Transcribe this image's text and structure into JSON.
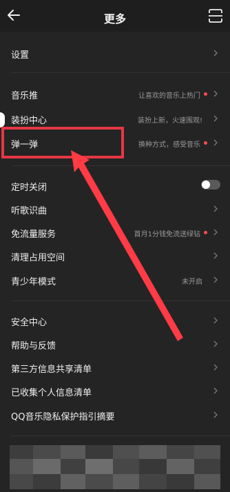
{
  "header": {
    "title": "更多",
    "back_icon": "back-arrow-icon",
    "scan_icon": "scan-icon"
  },
  "sections": {
    "settings": {
      "label": "设置"
    },
    "music_push": {
      "label": "音乐推",
      "hint": "让喜欢的音乐上热门"
    },
    "dress_center": {
      "label": "装扮中心",
      "hint": "装扮上新，火速围观!"
    },
    "tan_yi_tan": {
      "label": "弹一弹",
      "hint": "换种方式，感受音乐"
    },
    "timer_off": {
      "label": "定时关闭",
      "toggle_on": false
    },
    "song_recognition": {
      "label": "听歌识曲"
    },
    "free_data": {
      "label": "免流量服务",
      "hint": "首月1分钱免流送绿钻"
    },
    "clean_space": {
      "label": "清理占用空间"
    },
    "teen_mode": {
      "label": "青少年模式",
      "hint": "未开启"
    },
    "security": {
      "label": "安全中心"
    },
    "help": {
      "label": "帮助与反馈"
    },
    "third_party": {
      "label": "第三方信息共享清单"
    },
    "personal_info": {
      "label": "已收集个人信息清单"
    },
    "privacy": {
      "label": "QQ音乐隐私保护指引摘要"
    }
  },
  "colors": {
    "background": "#242424",
    "header": "#1e1e1e",
    "accent_red": "#e53744",
    "dot_red": "#ff4d4d",
    "hint_gray": "#9a9a9a"
  }
}
